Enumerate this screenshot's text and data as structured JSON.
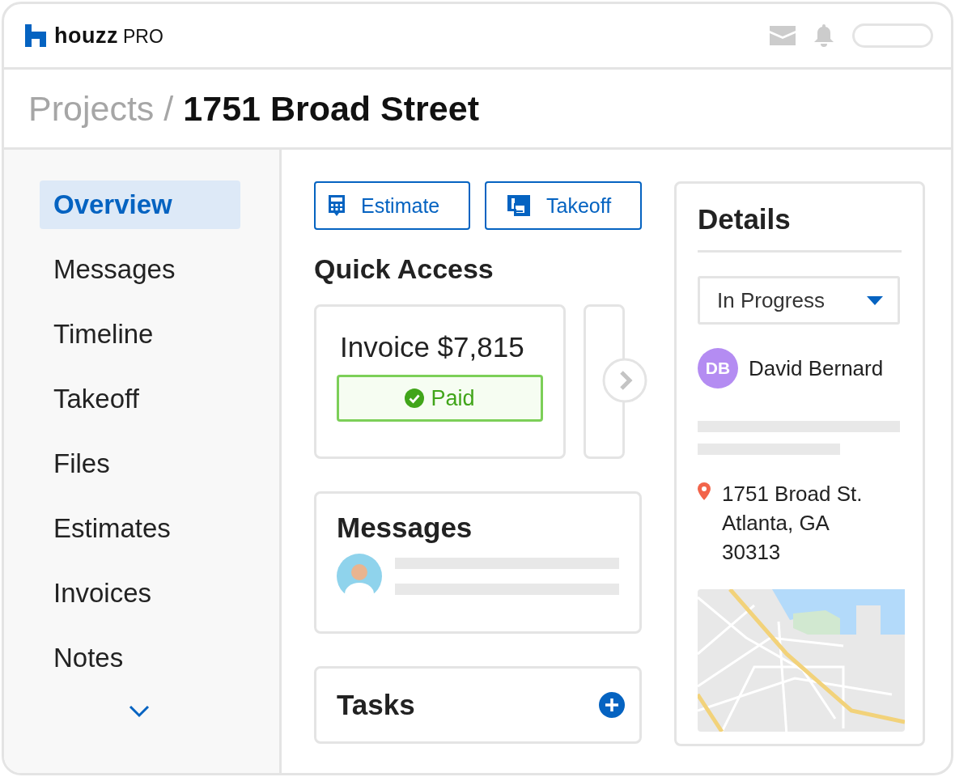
{
  "app": {
    "logo_text": "houzz",
    "logo_suffix": "PRO"
  },
  "breadcrumb": {
    "parent": "Projects",
    "separator": "/",
    "current": "1751 Broad Street"
  },
  "sidebar": {
    "items": [
      {
        "label": "Overview",
        "selected": true
      },
      {
        "label": "Messages",
        "selected": false
      },
      {
        "label": "Timeline",
        "selected": false
      },
      {
        "label": "Takeoff",
        "selected": false
      },
      {
        "label": "Files",
        "selected": false
      },
      {
        "label": "Estimates",
        "selected": false
      },
      {
        "label": "Invoices",
        "selected": false
      },
      {
        "label": "Notes",
        "selected": false
      }
    ]
  },
  "actions": [
    {
      "label": "Estimate",
      "kind": "calculator"
    },
    {
      "label": "Takeoff",
      "kind": "takeoff"
    }
  ],
  "quick_access": {
    "title": "Quick Access",
    "invoice": {
      "title": "Invoice $7,815",
      "status": "Paid",
      "paid": true
    }
  },
  "messages": {
    "title": "Messages"
  },
  "tasks": {
    "title": "Tasks"
  },
  "details": {
    "title": "Details",
    "status": "In Progress",
    "person": {
      "initials": "DB",
      "name": "David Bernard",
      "color": "#b48cf2"
    },
    "address": [
      "1751 Broad St.",
      "Atlanta, GA",
      "30313"
    ]
  }
}
